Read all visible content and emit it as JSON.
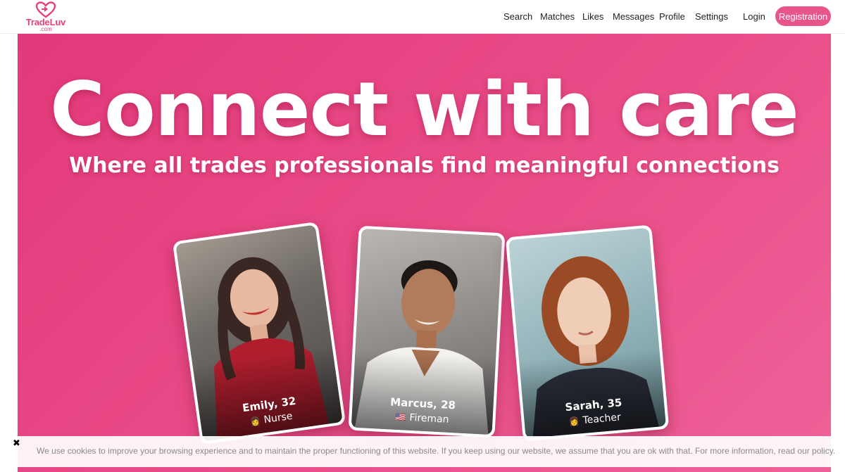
{
  "brand": {
    "name": "TradeLuv",
    "domain_suffix": ".com",
    "color": "#e8407a"
  },
  "nav": {
    "items": [
      "Search",
      "Matches",
      "Likes",
      "Messages",
      "Profile",
      "Settings"
    ],
    "login": "Login",
    "register": "Registration"
  },
  "hero": {
    "title": "Connect with care",
    "subtitle": "Where all trades professionals find meaningful connections",
    "bg_color": "#e8407a"
  },
  "profiles": [
    {
      "name": "Emily, 32",
      "job": "Nurse",
      "icon": "nurse-icon",
      "icon_char": "👩"
    },
    {
      "name": "Marcus, 28",
      "job": "Fireman",
      "icon": "flag-icon",
      "icon_char": "🇺🇸"
    },
    {
      "name": "Sarah, 35",
      "job": "Teacher",
      "icon": "teacher-icon",
      "icon_char": "👩"
    }
  ],
  "cookie": {
    "close": "✖",
    "text": "We use cookies to improve your browsing experience and to maintain the proper functioning of this website. If you keep using our website, we assume that you are ok with that. For more information, read our policy."
  }
}
